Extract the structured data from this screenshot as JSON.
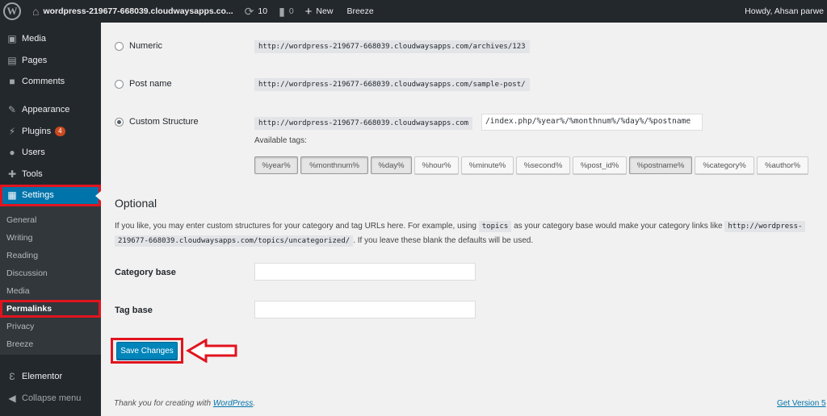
{
  "adminbar": {
    "site_name": "wordpress-219677-668039.cloudwaysapps.co...",
    "updates_count": "10",
    "comments_count": "0",
    "new_label": "New",
    "breeze_label": "Breeze",
    "howdy": "Howdy, Ahsan parwe"
  },
  "sidebar": {
    "items": [
      {
        "label": "Media",
        "icon": "media-icon"
      },
      {
        "label": "Pages",
        "icon": "pages-icon"
      },
      {
        "label": "Comments",
        "icon": "comments-icon"
      },
      {
        "label": "Appearance",
        "icon": "appearance-icon"
      },
      {
        "label": "Plugins",
        "icon": "plugins-icon",
        "badge": "4"
      },
      {
        "label": "Users",
        "icon": "users-icon"
      },
      {
        "label": "Tools",
        "icon": "tools-icon"
      },
      {
        "label": "Settings",
        "icon": "settings-icon"
      }
    ],
    "submenu": [
      "General",
      "Writing",
      "Reading",
      "Discussion",
      "Media",
      "Permalinks",
      "Privacy",
      "Breeze"
    ],
    "elementor": "Elementor",
    "collapse": "Collapse menu"
  },
  "permalinks": {
    "options": [
      {
        "label": "Numeric",
        "example": "http://wordpress-219677-668039.cloudwaysapps.com/archives/123"
      },
      {
        "label": "Post name",
        "example": "http://wordpress-219677-668039.cloudwaysapps.com/sample-post/"
      },
      {
        "label": "Custom Structure",
        "example": "http://wordpress-219677-668039.cloudwaysapps.com"
      }
    ],
    "custom_structure_value": "/index.php/%year%/%monthnum%/%day%/%postname",
    "available_tags_label": "Available tags:",
    "tags": [
      "%year%",
      "%monthnum%",
      "%day%",
      "%hour%",
      "%minute%",
      "%second%",
      "%post_id%",
      "%postname%",
      "%category%",
      "%author%"
    ],
    "active_tags": [
      "%year%",
      "%monthnum%",
      "%day%",
      "%postname%"
    ]
  },
  "optional": {
    "heading": "Optional",
    "desc_1": "If you like, you may enter custom structures for your category and tag URLs here. For example, using",
    "desc_code_1": "topics",
    "desc_2": "as your category base would make your category links like",
    "desc_code_2a": "http://wordpress-",
    "desc_code_2b": "219677-668039.cloudwaysapps.com/topics/uncategorized/",
    "desc_3": ". If you leave these blank the defaults will be used.",
    "category_base_label": "Category base",
    "category_base_value": "",
    "tag_base_label": "Tag base",
    "tag_base_value": ""
  },
  "save_button": "Save Changes",
  "footer": {
    "thank_you": "Thank you for creating with",
    "wordpress_link": "WordPress",
    "version_link": "Get Version 5"
  },
  "colors": {
    "adminbar": "#23282d",
    "accent": "#0073aa",
    "button": "#0085ba",
    "highlight": "#e1141e"
  }
}
